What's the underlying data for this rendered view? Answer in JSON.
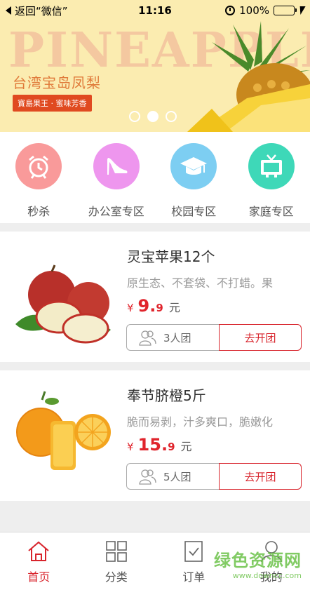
{
  "status_bar": {
    "back_label": "返回“微信”",
    "time": "11:16",
    "battery": "100%"
  },
  "banner": {
    "title": "PINEAPPLE",
    "subtitle": "台湾宝岛凤梨",
    "tag": "寶島果王 · 蜜味芳香",
    "slides": 3,
    "active_slide": 2
  },
  "categories": [
    {
      "label": "秒杀",
      "icon": "alarm-clock-icon",
      "color": "#f99a9a"
    },
    {
      "label": "办公室专区",
      "icon": "high-heel-icon",
      "color": "#ee96ee"
    },
    {
      "label": "校园专区",
      "icon": "graduation-cap-icon",
      "color": "#7dcef2"
    },
    {
      "label": "家庭专区",
      "icon": "tv-icon",
      "color": "#3ed8b8"
    }
  ],
  "products": [
    {
      "name": "灵宝苹果12个",
      "desc": "原生态、不套袋、不打蜡。果",
      "currency": "¥",
      "price_int": "9.",
      "price_dec": "9",
      "unit": "元",
      "group_size": "3人团",
      "join_label": "去开团",
      "image": "apple"
    },
    {
      "name": "奉节脐橙5斤",
      "desc": "脆而易剥，汁多爽口，脆嫩化",
      "currency": "¥",
      "price_int": "15.",
      "price_dec": "9",
      "unit": "元",
      "group_size": "5人团",
      "join_label": "去开团",
      "image": "orange"
    }
  ],
  "tabs": [
    {
      "label": "首页",
      "icon": "home-icon",
      "active": true
    },
    {
      "label": "分类",
      "icon": "grid-icon",
      "active": false
    },
    {
      "label": "订单",
      "icon": "order-icon",
      "active": false
    },
    {
      "label": "我的",
      "icon": "user-icon",
      "active": false
    }
  ],
  "watermark": {
    "line1": "绿色资源网",
    "line2": "www.downcc.com"
  },
  "colors": {
    "accent": "#d8242c",
    "banner_bg": "#fbecb0"
  }
}
